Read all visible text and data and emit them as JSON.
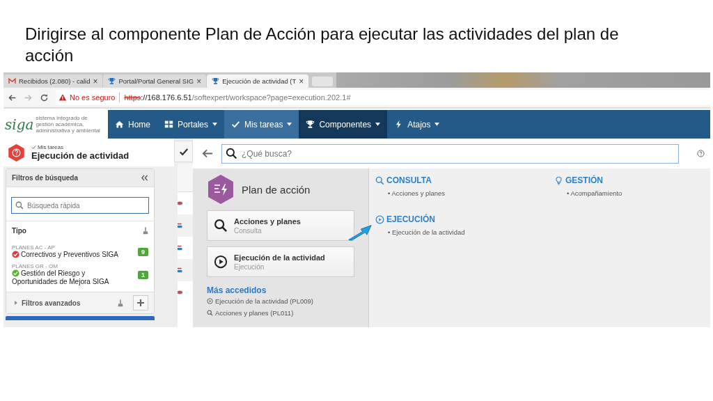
{
  "slide_title": "Dirigirse al componente Plan de Acción para ejecutar las actividades del plan de acción",
  "browser": {
    "tabs": [
      {
        "label": "Recibidos (2.080) - calid",
        "kind": "mail",
        "close": "×",
        "selected": false
      },
      {
        "label": "Portal/Portal General SIG",
        "kind": "trophy",
        "close": "×",
        "selected": false
      },
      {
        "label": "Ejecución de actividad (T",
        "kind": "trophy",
        "close": "×",
        "selected": true
      }
    ],
    "address": {
      "warning": "No es seguro",
      "scheme": "https",
      "host": "://168.176.6.51",
      "path": "/softexpert/workspace?page=execution.202.1#"
    }
  },
  "nav": {
    "logo": "siga",
    "tagline": "sistema integrado de gestión académica, administrativa y ambiental",
    "items": [
      {
        "label": "Home",
        "kind": "home",
        "dropdown": false,
        "current": false,
        "selected": false
      },
      {
        "label": "Portales",
        "kind": "grid",
        "dropdown": true,
        "current": false,
        "selected": false
      },
      {
        "label": "Mis tareas",
        "kind": "check",
        "dropdown": true,
        "current": true,
        "selected": false
      },
      {
        "label": "Componentes",
        "kind": "trophy",
        "dropdown": true,
        "current": false,
        "selected": true
      },
      {
        "label": "Atajos",
        "kind": "bolt",
        "dropdown": true,
        "current": false,
        "selected": false
      }
    ]
  },
  "task_header": {
    "breadcrumb": "Mis tareas",
    "title": "Ejecución de actividad"
  },
  "filters": {
    "title": "Filtros de búsqueda",
    "search_placeholder": "Búsqueda rápida",
    "section": "Tipo",
    "items": [
      {
        "group": "PLANES AC - AP",
        "name": "Correctivos y Preventivos SIGA",
        "count": "9",
        "color": "#e5383b"
      },
      {
        "group": "PLANES GR - OM",
        "name": "Gestión del Riesgo y Oportunidades de Mejora SIGA",
        "count": "1",
        "color": "#5cb531"
      }
    ],
    "advanced": "Filtros avanzados"
  },
  "task_list": {
    "rows": [
      {
        "kind": "eye"
      },
      {
        "kind": "flag"
      },
      {
        "kind": "flag"
      },
      {
        "kind": "flag"
      },
      {
        "kind": "eye"
      }
    ]
  },
  "search": {
    "placeholder": "¿Qué busca?"
  },
  "component": {
    "title": "Plan de acción",
    "cards": [
      {
        "title": "Acciones y planes",
        "subtitle": "Consulta",
        "kind": "search"
      },
      {
        "title": "Ejecución de la actividad",
        "subtitle": "Ejecución",
        "kind": "play"
      }
    ],
    "recent_title": "Más accedidos",
    "recent": [
      {
        "label": "Ejecución de la actividad (PL009)",
        "kind": "play"
      },
      {
        "label": "Acciones y planes (PL011)",
        "kind": "search"
      }
    ]
  },
  "categories": [
    {
      "title": "CONSULTA",
      "kind": "search",
      "items": [
        "• Acciones y planes"
      ]
    },
    {
      "title": "GESTIÓN",
      "kind": "bulb",
      "items": [
        "• Acompañamiento"
      ]
    },
    {
      "title": "EJECUCIÓN",
      "kind": "play",
      "items": [
        "• Ejecución de la actividad"
      ]
    }
  ]
}
